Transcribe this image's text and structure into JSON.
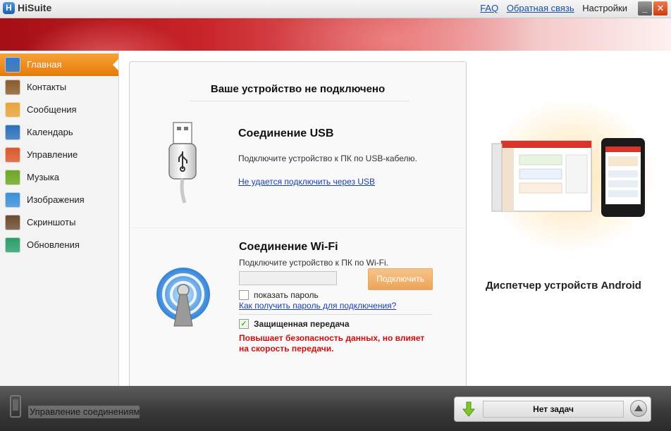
{
  "app": {
    "logo_letter": "H",
    "title": "HiSuite"
  },
  "top_links": {
    "faq": "FAQ",
    "feedback": "Обратная связь",
    "settings": "Настройки"
  },
  "window_controls": {
    "minimize": "_",
    "close": "✕"
  },
  "sidebar": {
    "items": [
      {
        "label": "Главная",
        "icon": "home-icon",
        "color": "#2d7bd6",
        "active": true
      },
      {
        "label": "Контакты",
        "icon": "contacts-icon",
        "color": "#8a5a2b",
        "active": false
      },
      {
        "label": "Сообщения",
        "icon": "envelope-icon",
        "color": "#e8a33a",
        "active": false
      },
      {
        "label": "Календарь",
        "icon": "calendar-icon",
        "color": "#2a6fb8",
        "active": false
      },
      {
        "label": "Управление",
        "icon": "apps-icon",
        "color": "#d8582a",
        "active": false
      },
      {
        "label": "Музыка",
        "icon": "music-icon",
        "color": "#6aa621",
        "active": false
      },
      {
        "label": "Изображения",
        "icon": "images-icon",
        "color": "#3a8fd8",
        "active": false
      },
      {
        "label": "Скриншоты",
        "icon": "camera-icon",
        "color": "#6b4a2d",
        "active": false
      },
      {
        "label": "Обновления",
        "icon": "refresh-icon",
        "color": "#2a9d6a",
        "active": false
      }
    ]
  },
  "main": {
    "heading": "Ваше устройство не подключено",
    "usb": {
      "title": "Соединение USB",
      "description": "Подключите устройство к ПК по USB-кабелю.",
      "help_link": "Не удается подключить через USB"
    },
    "wifi": {
      "title": "Соединение Wi-Fi",
      "description": "Подключите устройство к ПК по Wi-Fi.",
      "password_value": "",
      "connect_button": "Подключить",
      "show_password_label": "показать пароль",
      "show_password_checked": false,
      "how_link": "Как получить пароль для подключения?",
      "secure_label": "Защищенная передача",
      "secure_checked": true,
      "secure_check_glyph": "✓",
      "warning": "Повышает безопасность данных, но влияет на скорость передачи."
    }
  },
  "promo": {
    "caption": "Диспетчер устройств Android"
  },
  "bottom": {
    "connection_label": "Управление соединениями",
    "task_status": "Нет задач"
  },
  "colors": {
    "accent_orange": "#e67a09",
    "link_blue": "#1a3fb0",
    "warning_red": "#d10d0d",
    "banner_red": "#c8242a"
  }
}
